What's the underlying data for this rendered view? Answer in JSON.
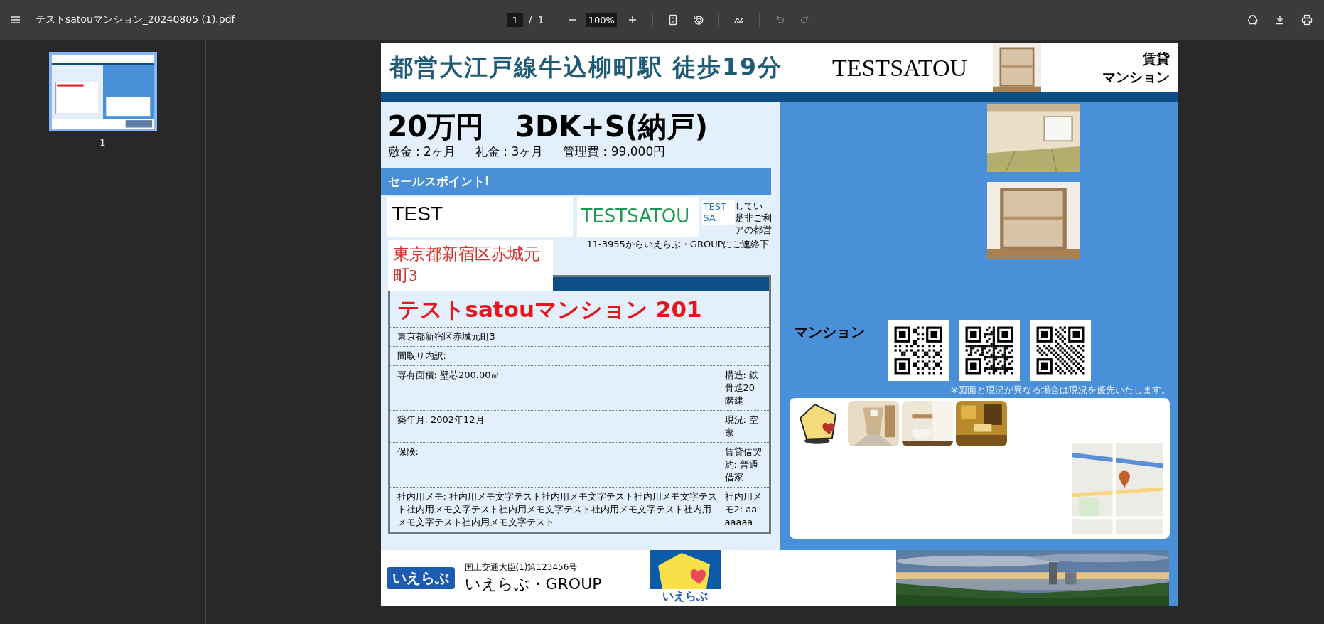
{
  "toolbar": {
    "file_name": "テストsatouマンション_20240805 (1).pdf",
    "page_number": "1",
    "page_separator": "/",
    "page_count": "1",
    "zoom": "100%",
    "actions": [
      {
        "kind": "fit-page",
        "disabled": false
      },
      {
        "kind": "rotate",
        "disabled": false
      },
      {
        "kind": "draw",
        "disabled": false
      },
      {
        "kind": "undo",
        "disabled": true
      },
      {
        "kind": "redo",
        "disabled": true
      }
    ],
    "right_actions": [
      {
        "kind": "save-to-drive"
      },
      {
        "kind": "download"
      },
      {
        "kind": "print"
      }
    ]
  },
  "sidebar": {
    "thumbnails": [
      {
        "label": "1",
        "selected": true
      }
    ]
  },
  "flyer": {
    "header": {
      "station": "都営大江戸線牛込柳町駅 徒歩19分",
      "brand": "TESTSATOU",
      "type_lines": [
        "賃貸",
        "マンション"
      ]
    },
    "price": {
      "rent": "20万円",
      "layout": "3DK+S(納戸)",
      "fees": [
        "敷金 : 2ヶ月",
        "礼金 : 3ヶ月",
        "管理費 : 99,000円"
      ]
    },
    "sales_point": {
      "heading": "セールスポイント!",
      "fragments": [
        "してい",
        "是非ご利",
        "アの都営"
      ],
      "bottom_line": "11-3955からいえらぶ・GROUPにご連絡下"
    },
    "overlays": {
      "test_box": "TEST",
      "brand_box": "TESTSATOU",
      "small_box": "TEST SA",
      "address_box": "東京都新宿区赤城元町3"
    },
    "property": {
      "name": "テストsatouマンション 201",
      "rows": [
        {
          "left": "東京都新宿区赤城元町3"
        },
        {
          "left": "間取り内訳:"
        },
        {
          "left": "専有面積: 壁芯200.00㎡",
          "right": "構造: 鉄骨造20階建"
        },
        {
          "left": "築年月: 2002年12月",
          "right": "現況: 空家"
        },
        {
          "left": "保険:",
          "right": "賃貸借契約: 普通借家"
        },
        {
          "left": "社内用メモ: 社内用メモ文字テスト社内用メモ文字テスト社内用メモ文字テスト社内用メモ文字テスト社内用メモ文字テスト社内用メモ文字テスト社内用メモ文字テスト社内用メモ文字テスト",
          "right": "社内用メモ2: aaaaaaa"
        }
      ]
    },
    "right_panel": {
      "label": "マンション",
      "qr_codes": [
        {
          "kind": "qr"
        },
        {
          "kind": "qr"
        },
        {
          "kind": "qr"
        }
      ],
      "note": "※図面と現況が異なる場合は現況を優先いたします。",
      "gallery": [
        {
          "kind": "mascot"
        },
        {
          "kind": "picture"
        },
        {
          "kind": "picture"
        },
        {
          "kind": "picture"
        }
      ]
    },
    "footer": {
      "logo": "いえらぶ",
      "license": "国土交通大臣(1)第123456号",
      "company": "いえらぶ・GROUP",
      "mascot_label": "いえらぶ"
    }
  }
}
